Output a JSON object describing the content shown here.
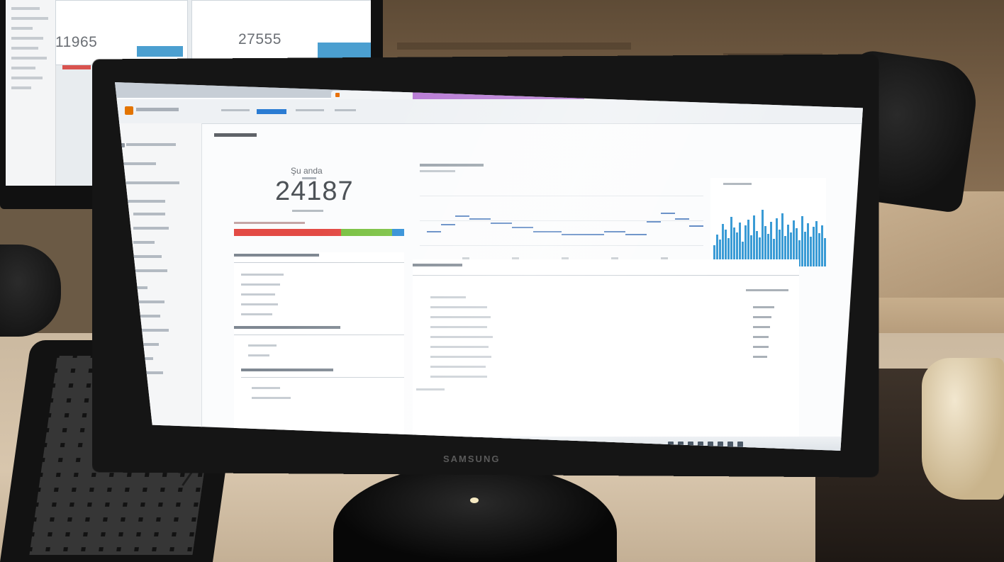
{
  "back_monitor": {
    "counter_left": "11965",
    "counter_right": "27555"
  },
  "main_monitor": {
    "brand": "SAMSUNG",
    "browser": {
      "active_tab": "",
      "purple_tab": ""
    },
    "analytics": {
      "realtime_label": "Şu anda",
      "active_users": "24187",
      "traffic_split": [
        {
          "color": "#e34b45",
          "fraction": 0.63
        },
        {
          "color": "#7ac142",
          "fraction": 0.3
        },
        {
          "color": "#2c8dd6",
          "fraction": 0.07
        }
      ]
    }
  },
  "colors": {
    "accent_blue": "#2b7cd3",
    "chart_blue": "#3a9bd5",
    "split_red": "#e34b45",
    "split_green": "#7ac142",
    "split_blue": "#2c8dd6"
  }
}
